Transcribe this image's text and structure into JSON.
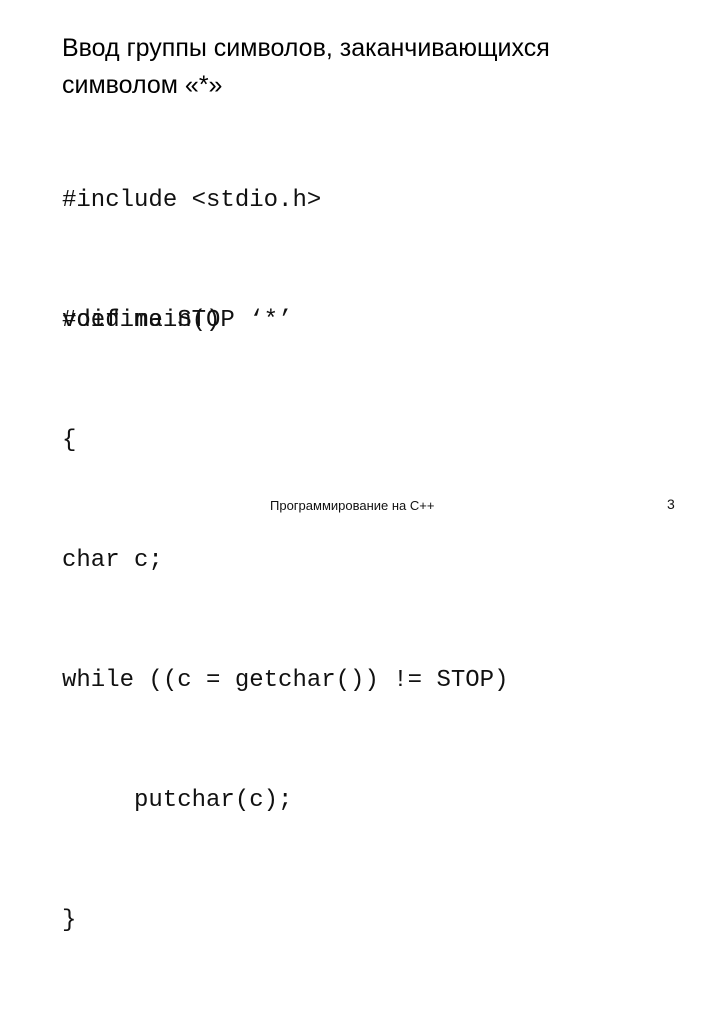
{
  "slide": {
    "title_lines": [
      "Ввод группы символов, заканчивающихся",
      "символом «*»"
    ],
    "preprocessor_lines": [
      "#include <stdio.h>",
      "#define STOP ‘*’"
    ],
    "code_lines": [
      "void main()",
      "{",
      "char c;",
      "while ((c = getchar()) != STOP)",
      "putchar(c);",
      "}"
    ],
    "footer": "Программирование на C++",
    "page_number": "3"
  }
}
